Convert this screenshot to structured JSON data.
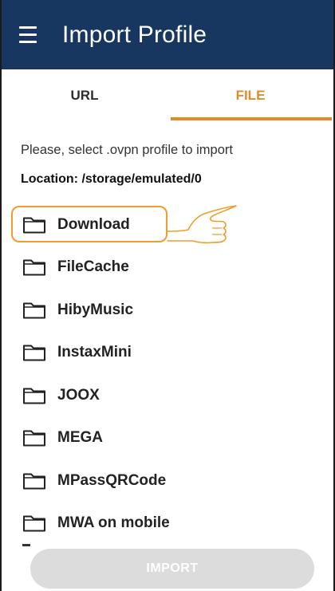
{
  "app_bar": {
    "title": "Import Profile",
    "background": "#183760"
  },
  "tabs": [
    {
      "label": "URL",
      "selected": false
    },
    {
      "label": "FILE",
      "selected": true
    }
  ],
  "accent_color": "#e48a2a",
  "prompt": "Please, select .ovpn profile to import",
  "location": "Location: /storage/emulated/0",
  "folders": [
    {
      "name": "Download",
      "highlighted": true
    },
    {
      "name": "FileCache"
    },
    {
      "name": "HibyMusic"
    },
    {
      "name": "InstaxMini"
    },
    {
      "name": "JOOX"
    },
    {
      "name": "MEGA"
    },
    {
      "name": "MPassQRCode"
    },
    {
      "name": "MWA on mobile"
    }
  ],
  "import_button": {
    "label": "IMPORT",
    "enabled": false
  }
}
